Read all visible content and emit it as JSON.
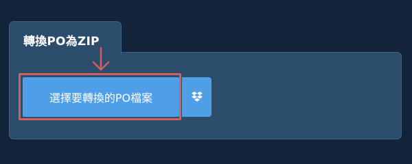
{
  "tab": {
    "label": "轉換PO為ZIP"
  },
  "upload": {
    "select_label": "選擇要轉換的PO檔案",
    "dropbox_icon": "dropbox-icon"
  },
  "colors": {
    "background": "#132338",
    "panel": "#2c4c6c",
    "button": "#4f9ee8",
    "highlight": "#d55f5f"
  }
}
